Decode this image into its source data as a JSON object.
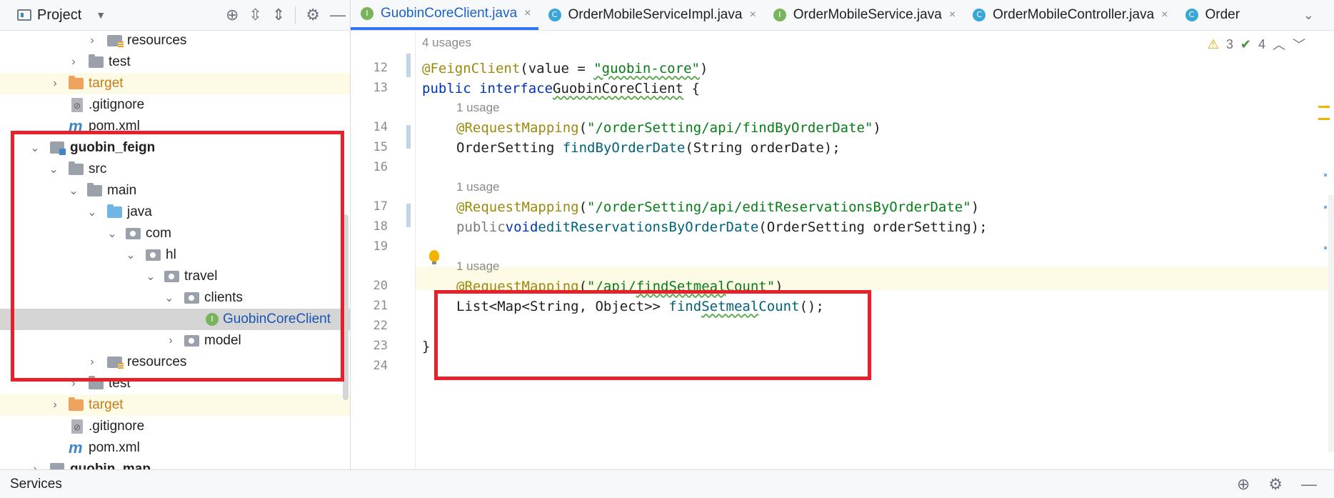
{
  "project_panel": {
    "title": "Project",
    "header_icons": [
      "locate-icon",
      "expand-all-icon",
      "collapse-all-icon",
      "gear-icon",
      "minimize-icon"
    ],
    "tree": [
      {
        "label": "resources",
        "type": "resources",
        "arrow": ">"
      },
      {
        "label": "test",
        "type": "folder",
        "arrow": ">"
      },
      {
        "label": "target",
        "type": "target",
        "arrow": ">"
      },
      {
        "label": ".gitignore",
        "type": "gitignore",
        "arrow": ""
      },
      {
        "label": "pom.xml",
        "type": "maven",
        "arrow": ""
      },
      {
        "label": "guobin_feign",
        "type": "module",
        "arrow": "v"
      },
      {
        "label": "src",
        "type": "folder",
        "arrow": "v"
      },
      {
        "label": "main",
        "type": "folder",
        "arrow": "v"
      },
      {
        "label": "java",
        "type": "source",
        "arrow": "v"
      },
      {
        "label": "com",
        "type": "package",
        "arrow": "v"
      },
      {
        "label": "hl",
        "type": "package",
        "arrow": "v"
      },
      {
        "label": "travel",
        "type": "package",
        "arrow": "v"
      },
      {
        "label": "clients",
        "type": "package",
        "arrow": "v"
      },
      {
        "label": "GuobinCoreClient",
        "type": "interface",
        "arrow": ""
      },
      {
        "label": "model",
        "type": "package",
        "arrow": ">"
      },
      {
        "label": "resources",
        "type": "resources",
        "arrow": ">"
      },
      {
        "label": "test",
        "type": "folder",
        "arrow": ">"
      },
      {
        "label": "target",
        "type": "target",
        "arrow": ">"
      },
      {
        "label": ".gitignore",
        "type": "gitignore",
        "arrow": ""
      },
      {
        "label": "pom.xml",
        "type": "maven",
        "arrow": ""
      },
      {
        "label": "guobin_map",
        "type": "module",
        "arrow": ">"
      }
    ]
  },
  "tabs": [
    {
      "label": "GuobinCoreClient.java",
      "kind": "I",
      "active": true
    },
    {
      "label": "OrderMobileServiceImpl.java",
      "kind": "C",
      "active": false
    },
    {
      "label": "OrderMobileService.java",
      "kind": "I",
      "active": false
    },
    {
      "label": "OrderMobileController.java",
      "kind": "C",
      "active": false
    },
    {
      "label": "Order",
      "kind": "C",
      "active": false
    }
  ],
  "inspection": {
    "warnings": "3",
    "ok": "4"
  },
  "code": {
    "top_hint": "4 usages",
    "lines": [
      {
        "no": "12",
        "text": "@FeignClient(value = \"guobin-core\")"
      },
      {
        "no": "13",
        "text": "public interface GuobinCoreClient {"
      },
      {
        "no": "",
        "text": "1 usage"
      },
      {
        "no": "14",
        "text": "@RequestMapping(\"/orderSetting/api/findByOrderDate\")"
      },
      {
        "no": "15",
        "text": "OrderSetting findByOrderDate(String orderDate);"
      },
      {
        "no": "16",
        "text": ""
      },
      {
        "no": "",
        "text": "1 usage"
      },
      {
        "no": "17",
        "text": "@RequestMapping(\"/orderSetting/api/editReservationsByOrderDate\")"
      },
      {
        "no": "18",
        "text": "public void editReservationsByOrderDate(OrderSetting orderSetting);"
      },
      {
        "no": "19",
        "text": ""
      },
      {
        "no": "",
        "text": "1 usage"
      },
      {
        "no": "20",
        "text": "@RequestMapping(\"/api/findSetmealCount\")"
      },
      {
        "no": "21",
        "text": "List<Map<String, Object>> findSetmealCount();"
      },
      {
        "no": "22",
        "text": ""
      },
      {
        "no": "23",
        "text": "}"
      },
      {
        "no": "24",
        "text": ""
      }
    ]
  },
  "status_bar": {
    "label": "Services"
  },
  "colors": {
    "highlight_box": "#e8202a",
    "active_tab": "#3574f0",
    "annotation": "#9e880d",
    "string": "#067d17",
    "keyword": "#0033b3",
    "method": "#00627a"
  }
}
